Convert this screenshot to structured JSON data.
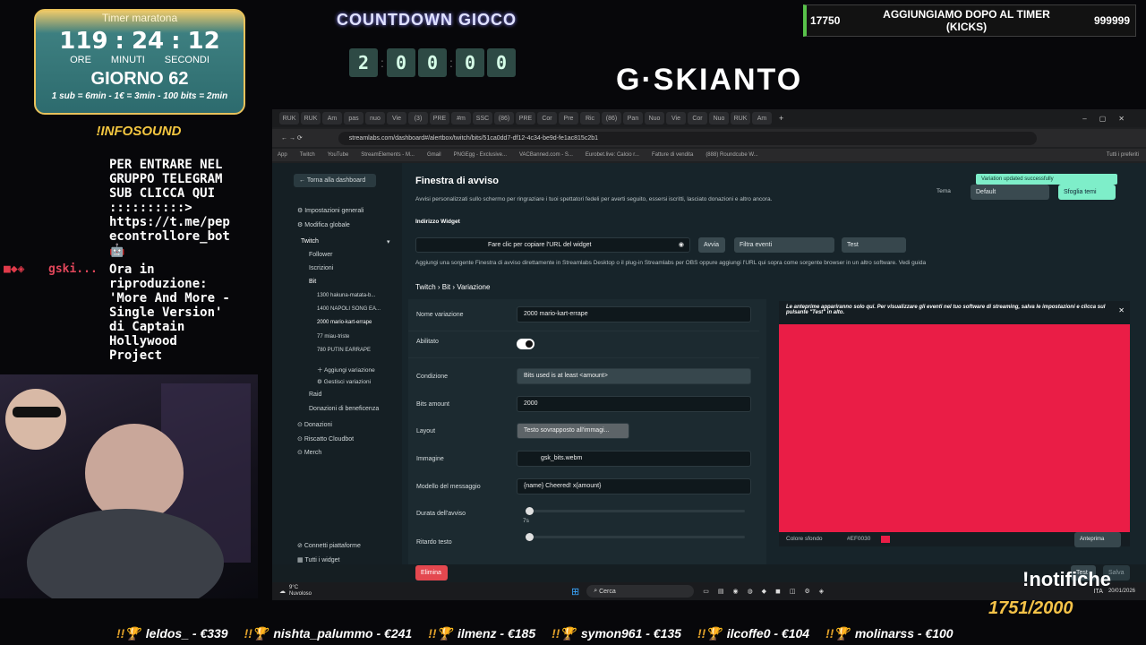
{
  "overlay": {
    "timer": {
      "title": "Timer maratona",
      "hours": "119",
      "minutes": "24",
      "seconds": "12",
      "hours_label": "ORE",
      "minutes_label": "MINUTI",
      "seconds_label": "SECONDI",
      "day": "GIORNO 62",
      "rates": "1 sub = 6min - 1€ = 3min - 100 bits = 2min"
    },
    "infosound": "!INFOSOUND",
    "chat": {
      "message_lines": [
        "PER ENTRARE NEL",
        "GRUPPO TELEGRAM",
        "SUB CLICCA QUI",
        "::::::::::>",
        "https://t.me/pep",
        "econtrollore_bot",
        "🤖"
      ],
      "user": "gski...",
      "now_playing_lines": [
        "Ora in",
        "riproduzione:",
        "'More And More -",
        "Single Version'",
        "di Captain",
        "Hollywood",
        "Project"
      ]
    },
    "countdown": {
      "title": "COUNTDOWN GIOCO",
      "digits": [
        "2",
        "0",
        "0",
        "0",
        "0"
      ]
    },
    "logo": "G·SKIANTO",
    "kicks": {
      "current": "17750",
      "label_line1": "AGGIUNGIAMO DOPO AL TIMER",
      "label_line2": "(KICKS)",
      "goal": "999999"
    },
    "notifiche": "!notifiche",
    "counter": "1751/2000",
    "ticker": [
      "leldos_ - €339",
      "nishta_palummo - €241",
      "ilmenz - €185",
      "symon961 - €135",
      "ilcoffe0 - €104",
      "molinarss - €100"
    ]
  },
  "browser": {
    "url": "streamlabs.com/dashboard#/alertbox/twitch/bits/51ca0dd7-df12-4c34-be9d-fe1ac815c2b1",
    "bookmarks": [
      "App",
      "Twitch",
      "YouTube",
      "StreamElements - M...",
      "Gmail",
      "PNGEgg - Exclusive...",
      "VACBanned.com - S...",
      "Eurobet.live: Calcio r...",
      "Fatture di vendita",
      "(888) Roundcube W...",
      "Tutti i preferiti"
    ],
    "tab_labels": [
      "RUK",
      "RUK",
      "Am",
      "pas",
      "nuo",
      "Vie",
      "(3)",
      "PRE",
      "#m",
      "SSC",
      "(86)",
      "PRE",
      "Cor",
      "Pre",
      "Ric",
      "(86)",
      "Pan",
      "Nuo",
      "Vie",
      "Cor",
      "Nuo",
      "RUK",
      "Am"
    ]
  },
  "sidebar": {
    "back": "Torna alla dashboard",
    "items": {
      "general_settings": "Impostazioni generali",
      "global_edit": "Modifica globale",
      "twitch": "Twitch",
      "follower": "Follower",
      "iscrizioni": "Iscrizioni",
      "bit": "Bit",
      "variations": [
        "1300 hakuna-matata-b...",
        "1400 NAPOLI SONG EA...",
        "2000 mario-kart-errape",
        "77 miau-triste",
        "780 PUTIN EARRAPE"
      ],
      "add_variation": "Aggiungi variazione",
      "manage_variations": "Gestisci variazioni",
      "raid": "Raid",
      "charity": "Donazioni di beneficenza",
      "donazioni": "Donazioni",
      "riscatto": "Riscatto Cloudbot",
      "merch": "Merch",
      "connect_platforms": "Connetti piattaforme",
      "all_widgets": "Tutti i widget"
    }
  },
  "main": {
    "title": "Finestra di avviso",
    "subtitle": "Avvisi personalizzati sullo schermo per ringraziare i tuoi spettatori fedeli per averti seguito, essersi iscritti, lasciato donazioni e altro ancora.",
    "theme_label": "Tema",
    "theme_value": "Default",
    "browse_themes": "Sfoglia temi",
    "toast": "Variation updated successfully",
    "widget_address_label": "Indirizzo Widget",
    "copy_url": "Fare clic per copiare l'URL del widget",
    "launch": "Avvia",
    "filter_events": "Filtra eventi",
    "test": "Test",
    "help_text": "Aggiungi una sorgente Finestra di avviso direttamente in Streamlabs Desktop o il plug-in Streamlabs per OBS oppure aggiungi l'URL qui sopra come sorgente browser in un altro software. Vedi guida",
    "breadcrumb": "Twitch › Bit › Variazione",
    "form": {
      "variation_name_label": "Nome variazione",
      "variation_name_value": "2000 mario-kart-errape",
      "enabled_label": "Abilitato",
      "condition_label": "Condizione",
      "condition_value": "Bits used is at least <amount>",
      "bits_amount_label": "Bits amount",
      "bits_amount_value": "2000",
      "layout_label": "Layout",
      "layout_value": "Testo sovrapposto all'immagi...",
      "image_label": "Immagine",
      "image_value": "gsk_bits.webm",
      "message_template_label": "Modello del messaggio",
      "message_template_value": "{name} Cheered! x{amount}",
      "alert_duration_label": "Durata dell'avviso",
      "alert_duration_value": "7s",
      "text_delay_label": "Ritardo testo",
      "delete": "Elimina"
    },
    "preview": {
      "notice": "Le anteprime appariranno solo qui. Per visualizzare gli eventi nel tuo software di streaming, salva le impostazioni e clicca sul pulsante \"Test\" in alto.",
      "bg_color_label": "Colore sfondo",
      "bg_color_value": "#EF0030",
      "preview_button": "Anteprima",
      "test_button": "Test",
      "save_button": "Salva",
      "bg_color": "#ea1d46"
    }
  },
  "taskbar": {
    "weather_temp": "9°C",
    "weather_desc": "Nuvoloso",
    "search": "Cerca",
    "lang": "ITA",
    "date": "20/01/2026"
  }
}
